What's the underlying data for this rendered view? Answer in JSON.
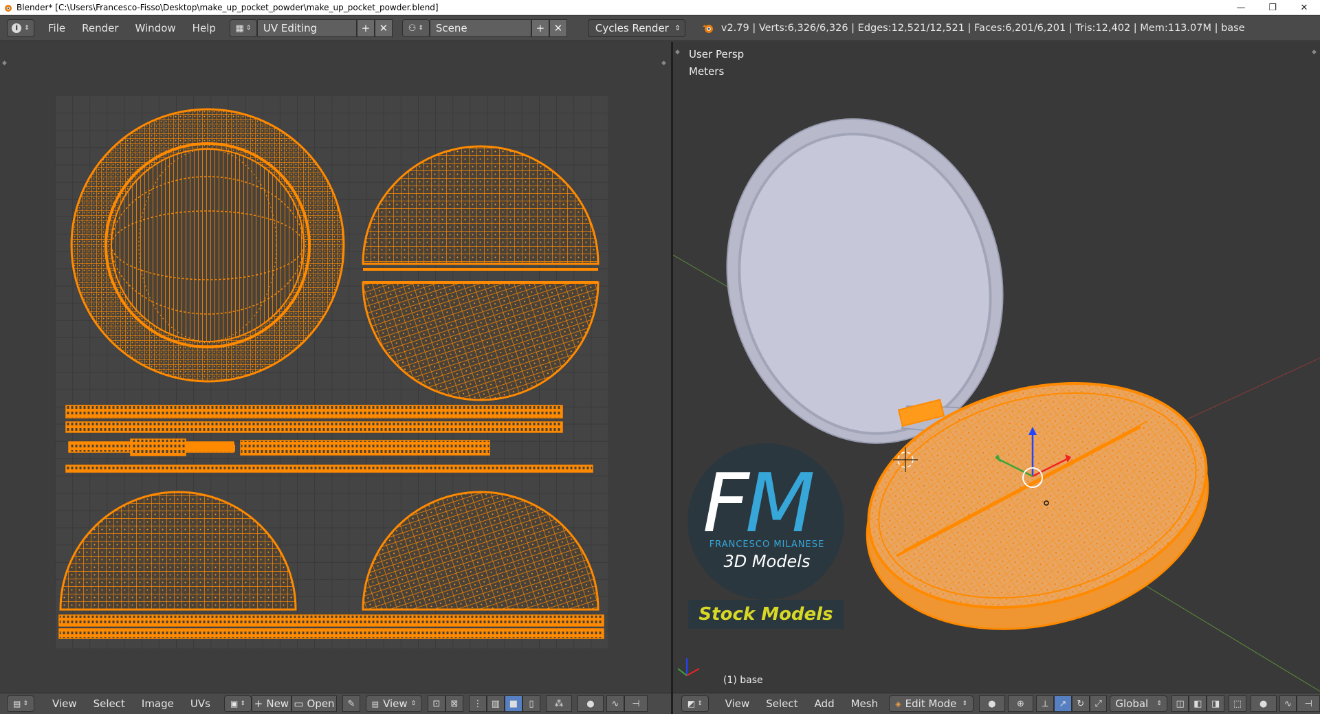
{
  "window": {
    "title": "Blender* [C:\\Users\\Francesco-Fisso\\Desktop\\make_up_pocket_powder\\make_up_pocket_powder.blend]",
    "minimize": "—",
    "maximize": "❐",
    "close": "✕"
  },
  "info_header": {
    "editor_type_icon": "info-icon",
    "menus": [
      "File",
      "Render",
      "Window",
      "Help"
    ],
    "screen_layout": "UV Editing",
    "scene": "Scene",
    "render_engine": "Cycles Render",
    "stats": "v2.79 | Verts:6,326/6,326 | Edges:12,521/12,521 | Faces:6,201/6,201 | Tris:12,402 | Mem:113.07M | base"
  },
  "uv_editor": {
    "menus": [
      "View",
      "Select",
      "Image",
      "UVs"
    ],
    "new_label": "New",
    "open_label": "Open",
    "view_label": "View"
  },
  "viewport": {
    "view_name": "User Persp",
    "units": "Meters",
    "object_label": "(1) base",
    "menus": [
      "View",
      "Select",
      "Add",
      "Mesh"
    ],
    "mode": "Edit Mode",
    "orientation": "Global"
  },
  "watermark": {
    "letter_f": "F",
    "letter_m": "M",
    "name": "FRANCESCO MILANESE",
    "tagline": "3D Models",
    "stock": "Stock Models"
  },
  "colors": {
    "uv_orange": "#ff8a00",
    "panel_bg": "#3d3d3d",
    "header_bg": "#4a4a4a",
    "lid_color": "#c2c4d6",
    "fm_blue": "#36a7d8",
    "stock_yellow": "#d8d826"
  }
}
